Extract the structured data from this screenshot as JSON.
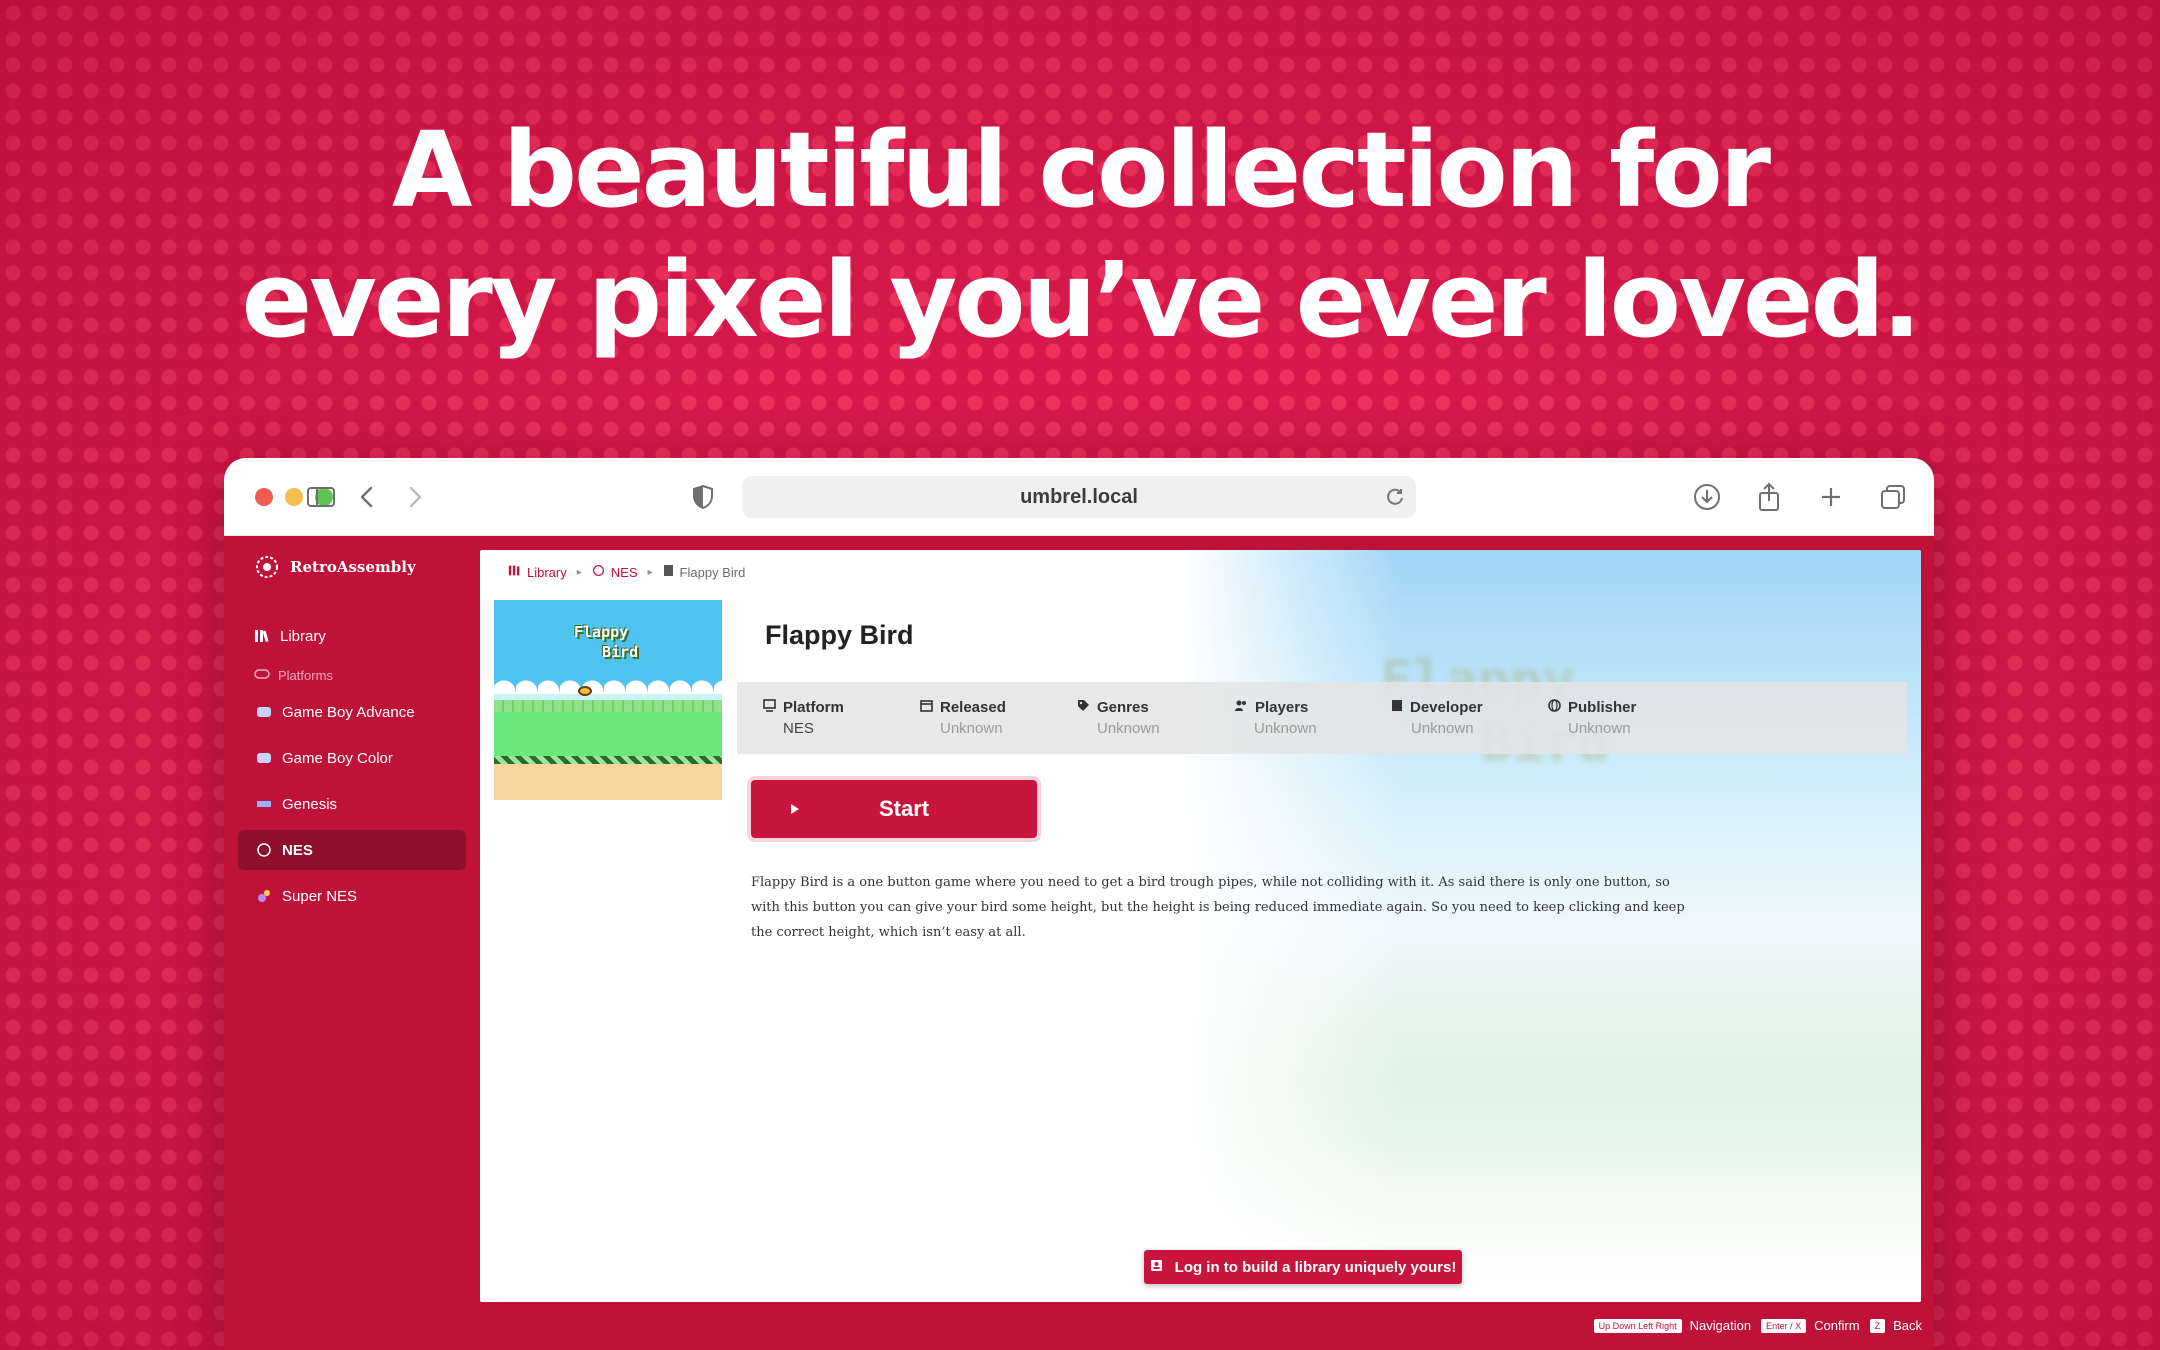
{
  "headline": {
    "line1": "A beautiful collection for",
    "line2": "every pixel you’ve ever loved."
  },
  "browser": {
    "url": "umbrel.local"
  },
  "sidebar": {
    "brand": "RetroAssembly",
    "library_label": "Library",
    "section_label": "Platforms",
    "platforms": [
      {
        "label": "Game Boy Advance",
        "icon": "gba-icon"
      },
      {
        "label": "Game Boy Color",
        "icon": "gbc-icon"
      },
      {
        "label": "Genesis",
        "icon": "genesis-icon"
      },
      {
        "label": "NES",
        "icon": "nes-icon",
        "active": true
      },
      {
        "label": "Super NES",
        "icon": "snes-icon"
      }
    ]
  },
  "breadcrumb": {
    "library": "Library",
    "platform": "NES",
    "game": "Flappy Bird"
  },
  "game": {
    "cover_line1": "Flappy",
    "cover_line2": "Bird",
    "title": "Flappy Bird",
    "meta": [
      {
        "label": "Platform",
        "value": "NES",
        "icon": "monitor-icon"
      },
      {
        "label": "Released",
        "value": "Unknown",
        "icon": "calendar-icon"
      },
      {
        "label": "Genres",
        "value": "Unknown",
        "icon": "tag-icon"
      },
      {
        "label": "Players",
        "value": "Unknown",
        "icon": "users-icon"
      },
      {
        "label": "Developer",
        "value": "Unknown",
        "icon": "book-icon"
      },
      {
        "label": "Publisher",
        "value": "Unknown",
        "icon": "globe-icon"
      }
    ],
    "start_label": "Start",
    "description": "Flappy Bird is a one button game where you need to get a bird trough pipes, while not colliding with it. As said there is only one button, so with this button you can give your bird some height, but the height is being reduced immediate again. So you need to keep clicking and keep the correct height, which isn’t easy at all."
  },
  "login_button": "Log in to build a library uniquely yours!",
  "hints": {
    "nav_key": "Up Down Left Right",
    "nav_label": "Navigation",
    "confirm_key": "Enter / X",
    "confirm_label": "Confirm",
    "back_key": "Z",
    "back_label": "Back"
  },
  "colors": {
    "brand_red": "#c8153d",
    "background": "#d6194a",
    "sidebar_active": "#8e0f2c"
  }
}
